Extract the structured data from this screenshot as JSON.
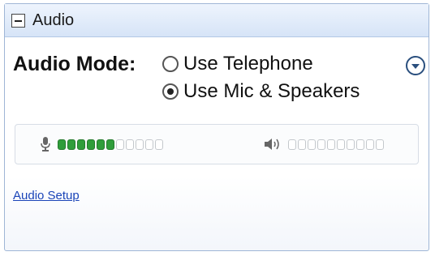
{
  "panel": {
    "title": "Audio"
  },
  "audio_mode": {
    "label": "Audio Mode:",
    "options": [
      {
        "label": "Use Telephone",
        "selected": false
      },
      {
        "label": "Use Mic & Speakers",
        "selected": true
      }
    ]
  },
  "levels": {
    "mic": {
      "icon": "microphone-icon",
      "active": 6,
      "total": 11
    },
    "speaker": {
      "icon": "speaker-icon",
      "active": 0,
      "total": 10
    },
    "active_color": "#2f9d3a"
  },
  "links": {
    "audio_setup": "Audio Setup"
  },
  "colors": {
    "title_gradient_top": "#eef4fd",
    "title_gradient_bottom": "#d6e4f7",
    "link": "#1a44b8"
  }
}
